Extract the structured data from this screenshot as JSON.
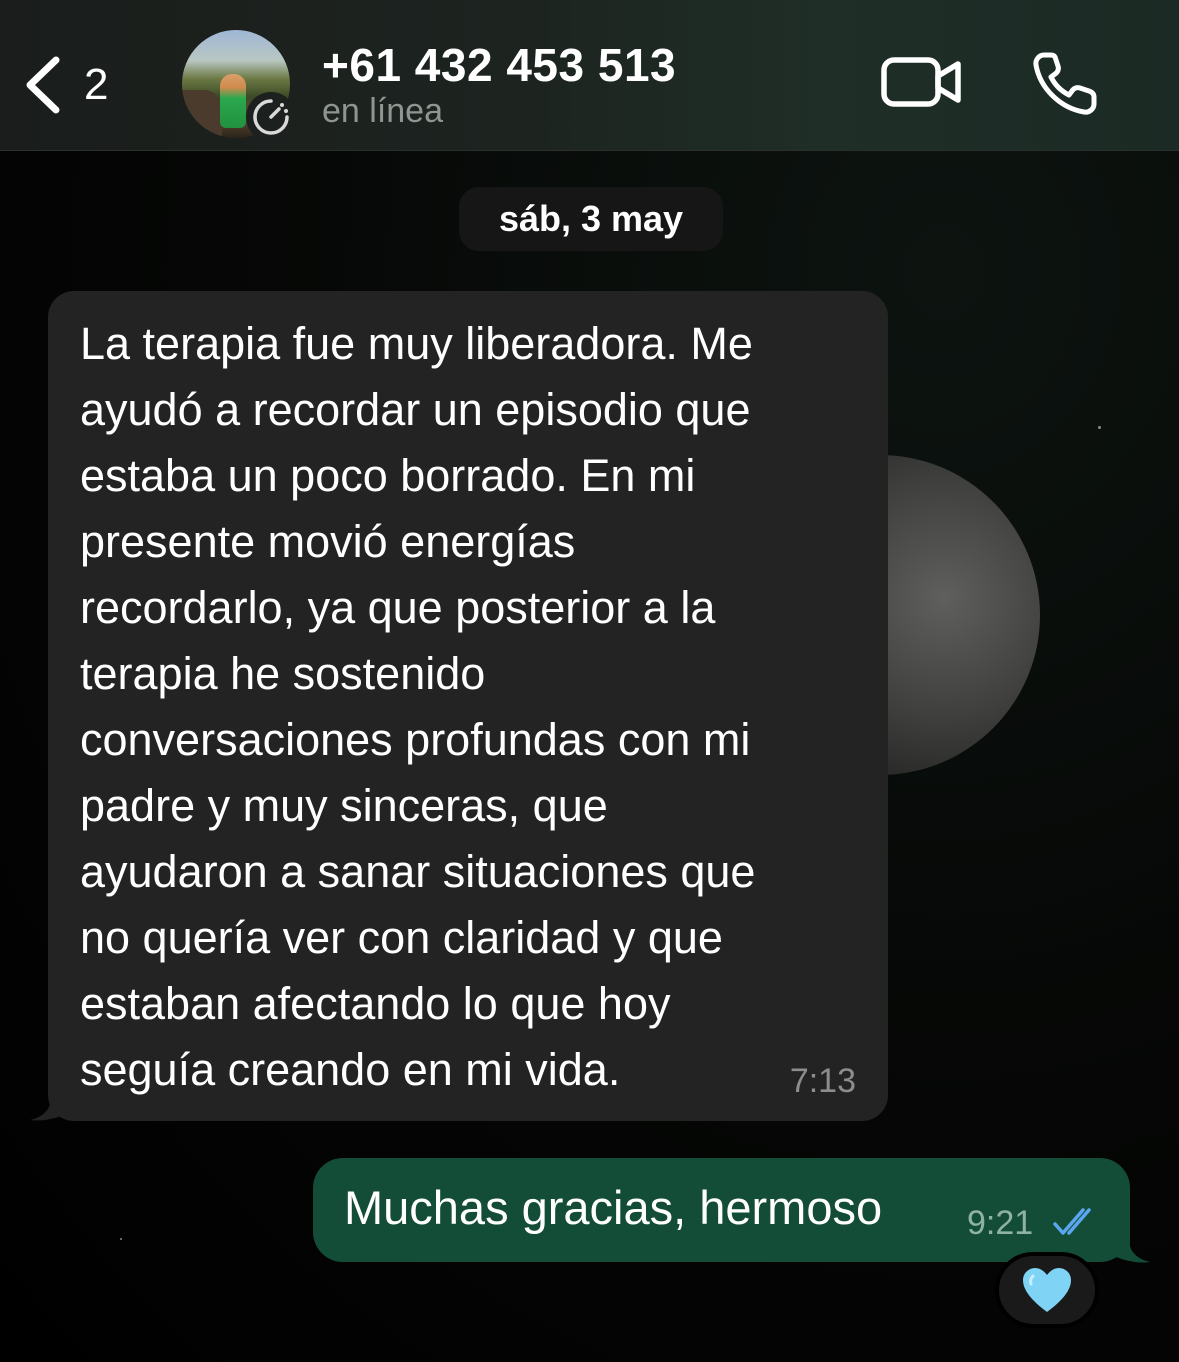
{
  "header": {
    "back_count": "2",
    "contact_name": "+61 432 453 513",
    "contact_status": "en línea",
    "icons": {
      "back": "chevron-left-icon",
      "video": "video-camera-icon",
      "call": "phone-icon",
      "status": "status-ring-icon"
    }
  },
  "date_separator": "sáb, 3 may",
  "messages": [
    {
      "direction": "incoming",
      "text": "La terapia fue muy liberadora. Me\nayudó a recordar un episodio que\nestaba un poco borrado. En mi\npresente movió energías\nrecordarlo, ya que posterior a la\nterapia he sostenido\nconversaciones profundas con mi\npadre y muy sinceras, que\nayudaron a sanar situaciones que\nno quería ver con claridad y que\nestaban afectando lo que hoy\nseguía creando en mi vida.",
      "time": "7:13"
    },
    {
      "direction": "outgoing",
      "text": "Muchas gracias, hermoso",
      "time": "9:21",
      "status_icon": "double-check-read-icon",
      "reaction": "🩵"
    }
  ],
  "colors": {
    "header_bg": "#1d2420",
    "incoming_bubble": "#232323",
    "outgoing_bubble": "#144d37",
    "read_tick": "#5aa6f0",
    "heart": "#7fd3f5"
  }
}
